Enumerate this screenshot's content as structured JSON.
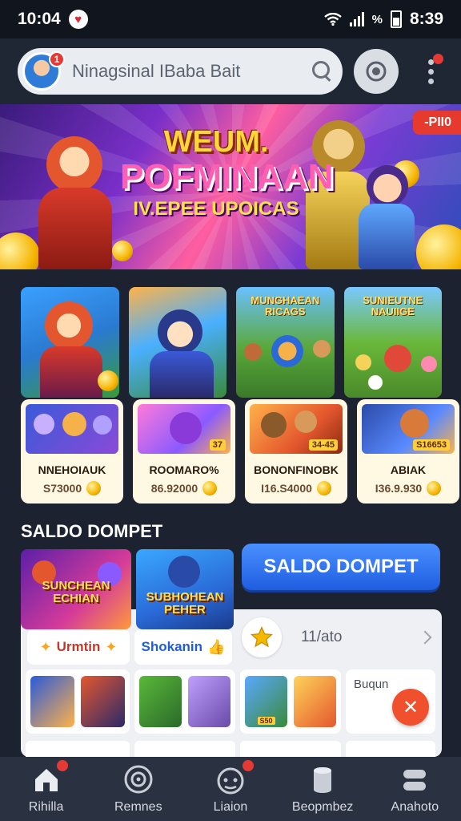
{
  "status_bar": {
    "time": "10:04",
    "battery_percent_symbol": "%",
    "clock_right": "8:39"
  },
  "header": {
    "search_text": "Ninagsinal IBaba Bait",
    "avatar_badge": "1"
  },
  "banner": {
    "line1": "WEUM.",
    "line2": "POFMINAAN",
    "line3": "IV.EPEE UPOICAS",
    "corner_badge": "-PII0"
  },
  "games": {
    "art": [
      {
        "text": ""
      },
      {
        "text": ""
      },
      {
        "text": "MUNGHAEAN RICAGS"
      },
      {
        "text": "SUNIEUTNE NAUIIGE"
      }
    ],
    "cards": [
      {
        "name": "NNEHOIAUK",
        "value": "S73000",
        "tag": ""
      },
      {
        "name": "ROOMARO%",
        "value": "86.92000",
        "tag": "37"
      },
      {
        "name": "BONONFINOBK",
        "value": "I16.S4000",
        "tag": "34-45"
      },
      {
        "name": "ABIAK",
        "value": "I36.9.930",
        "tag": "S16653"
      }
    ]
  },
  "saldo": {
    "section_title": "SALDO DOMPET",
    "button_label": "SALDO DOMPET",
    "promo_left_text": "SUNCHEAN ECHIAN",
    "promo_mid_text": "SUBHOHEAN PEHER",
    "tab_left": "Urmtin",
    "tab_right": "Shokanin",
    "count_text": "11/ato",
    "last_card_label": "Buqun",
    "mini_tags": [
      "",
      "",
      "S50",
      ""
    ]
  },
  "bottom_nav": {
    "items": [
      {
        "label": "Rihilla"
      },
      {
        "label": "Remnes"
      },
      {
        "label": "Liaion"
      },
      {
        "label": "Beopmbez"
      },
      {
        "label": "Anahoto"
      }
    ]
  },
  "colors": {
    "background": "#1c2230",
    "accent_blue": "#1f5de0",
    "badge_red": "#e53935"
  }
}
